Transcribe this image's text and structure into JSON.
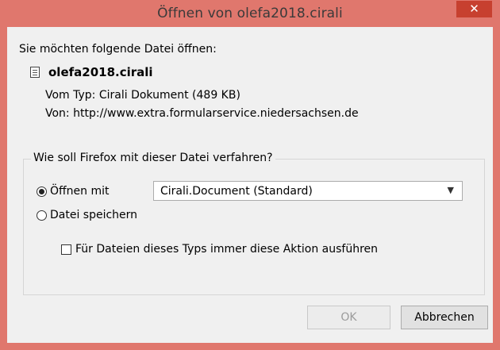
{
  "window": {
    "title": "Öffnen von olefa2018.cirali",
    "close_glyph": "✕"
  },
  "prompt": "Sie möchten folgende Datei öffnen:",
  "file": {
    "icon": "document-icon",
    "name": "olefa2018.cirali",
    "type_label": "Vom Typ:",
    "type_value": "Cirali Dokument (489 KB)",
    "from_label": "Von:",
    "from_value": "http://www.extra.formularservice.niedersachsen.de"
  },
  "action_group": {
    "legend": "Wie soll Firefox mit dieser Datei verfahren?",
    "open_with_label": "Öffnen mit",
    "open_with_selected": "Cirali.Document (Standard)",
    "open_with_checked": true,
    "save_label": "Datei speichern",
    "save_checked": false,
    "remember_label": "Für Dateien dieses Typs immer diese Aktion ausführen",
    "remember_checked": false
  },
  "buttons": {
    "ok_label": "OK",
    "cancel_label": "Abbrechen"
  }
}
